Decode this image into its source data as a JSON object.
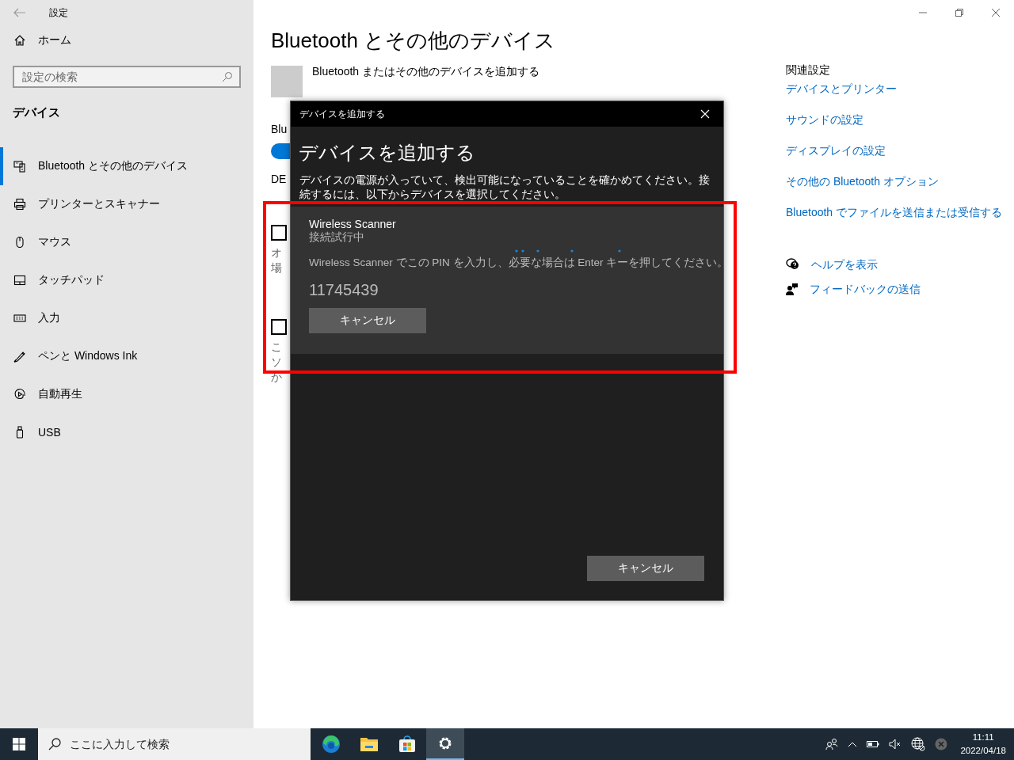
{
  "window": {
    "title": "設定"
  },
  "sidebar": {
    "home": "ホーム",
    "search": {
      "placeholder": "設定の検索"
    },
    "section": "デバイス",
    "items": [
      {
        "kind": "bluetooth",
        "label": "Bluetooth とその他のデバイス",
        "selected": true
      },
      {
        "kind": "printer",
        "label": "プリンターとスキャナー",
        "selected": false
      },
      {
        "kind": "mouse",
        "label": "マウス",
        "selected": false
      },
      {
        "kind": "touchpad",
        "label": "タッチパッド",
        "selected": false
      },
      {
        "kind": "keyboard",
        "label": "入力",
        "selected": false
      },
      {
        "kind": "pen",
        "label": "ペンと Windows Ink",
        "selected": false
      },
      {
        "kind": "autoplay",
        "label": "自動再生",
        "selected": false
      },
      {
        "kind": "usb",
        "label": "USB",
        "selected": false
      }
    ]
  },
  "page": {
    "title": "Bluetooth とその他のデバイス",
    "add_device_label": "Bluetooth またはその他のデバイスを追加する",
    "bluetooth_label": "Blu",
    "bluetooth_toggle": {
      "on": true
    },
    "section_fragment": "DE",
    "options": [
      {
        "checked": false,
        "lines": [
          "オ",
          "場"
        ]
      },
      {
        "checked": false,
        "lines": [
          "こ",
          "ソ",
          "か"
        ]
      }
    ]
  },
  "related": {
    "title": "関連設定",
    "links": [
      "デバイスとプリンター",
      "サウンドの設定",
      "ディスプレイの設定",
      "その他の Bluetooth オプション",
      "Bluetooth でファイルを送信または受信する"
    ]
  },
  "help": [
    {
      "kind": "help",
      "label": "ヘルプを表示"
    },
    {
      "kind": "feedback",
      "label": "フィードバックの送信"
    }
  ],
  "dialog": {
    "title": "デバイスを追加する",
    "heading": "デバイスを追加する",
    "description": "デバイスの電源が入っていて、検出可能になっていることを確かめてください。接続するには、以下からデバイスを選択してください。",
    "device": {
      "name": "Wireless Scanner",
      "status": "接続試行中",
      "instruction": "Wireless Scanner でこの PIN を入力し、必要な場合は Enter キーを押してください。",
      "pin": "11745439",
      "cancel": "キャンセル"
    },
    "cancel": "キャンセル"
  },
  "taskbar": {
    "search_placeholder": "ここに入力して検索",
    "apps": [
      {
        "kind": "edge",
        "active": false
      },
      {
        "kind": "folder",
        "active": false
      },
      {
        "kind": "store",
        "active": false
      },
      {
        "kind": "settings",
        "active": true
      }
    ],
    "time": "11:11",
    "date": "2022/04/18"
  }
}
